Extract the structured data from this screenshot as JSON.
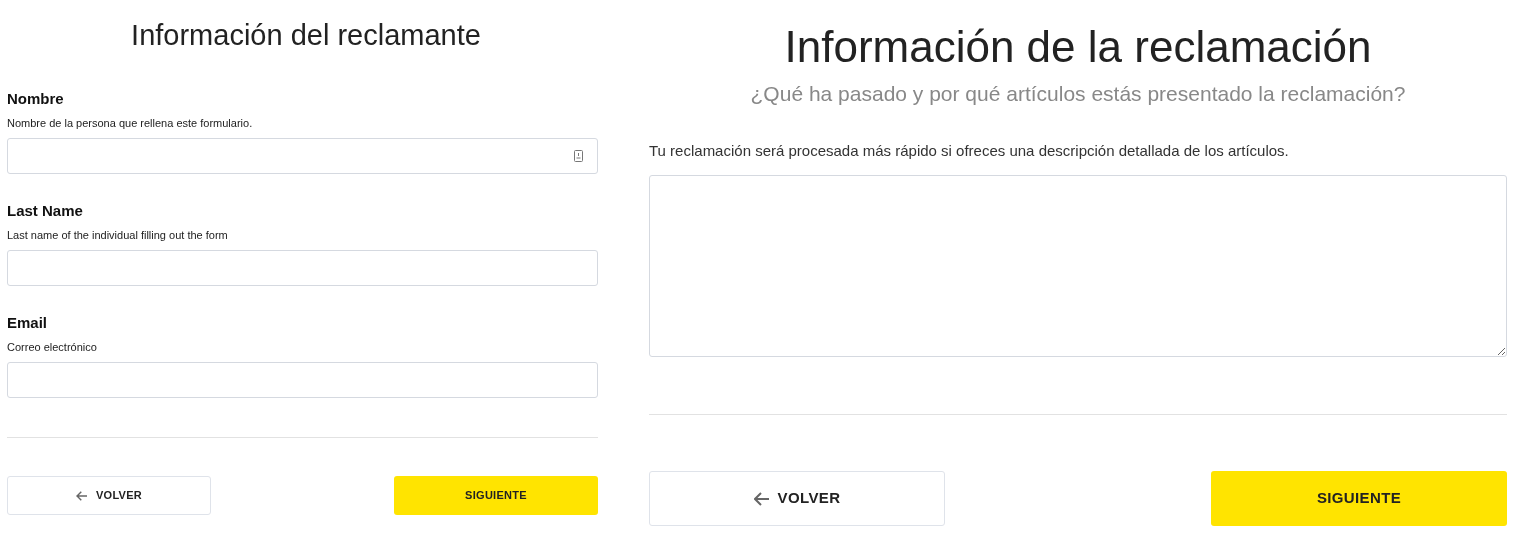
{
  "claimant_form": {
    "title": "Información del reclamante",
    "fields": [
      {
        "label": "Nombre",
        "hint": "Nombre de la persona que rellena este formulario.",
        "kind": "autofill"
      },
      {
        "label": "Last Name",
        "hint": "Last name of the individual filling out the form",
        "kind": "plain"
      },
      {
        "label": "Email",
        "hint": "Correo electrónico",
        "kind": "plain"
      }
    ],
    "buttons": [
      {
        "label": "VOLVER",
        "kind": "back"
      },
      {
        "label": "SIGUIENTE",
        "kind": "next"
      }
    ]
  },
  "claim_form": {
    "title": "Información de la reclamación",
    "subtitle": "¿Qué ha pasado y por qué artículos estás presentado la reclamación?",
    "prompt": "Tu reclamación será procesada más rápido si ofreces una descripción detallada de los artículos.",
    "buttons": [
      {
        "label": "VOLVER",
        "kind": "back"
      },
      {
        "label": "SIGUIENTE",
        "kind": "next"
      }
    ]
  }
}
